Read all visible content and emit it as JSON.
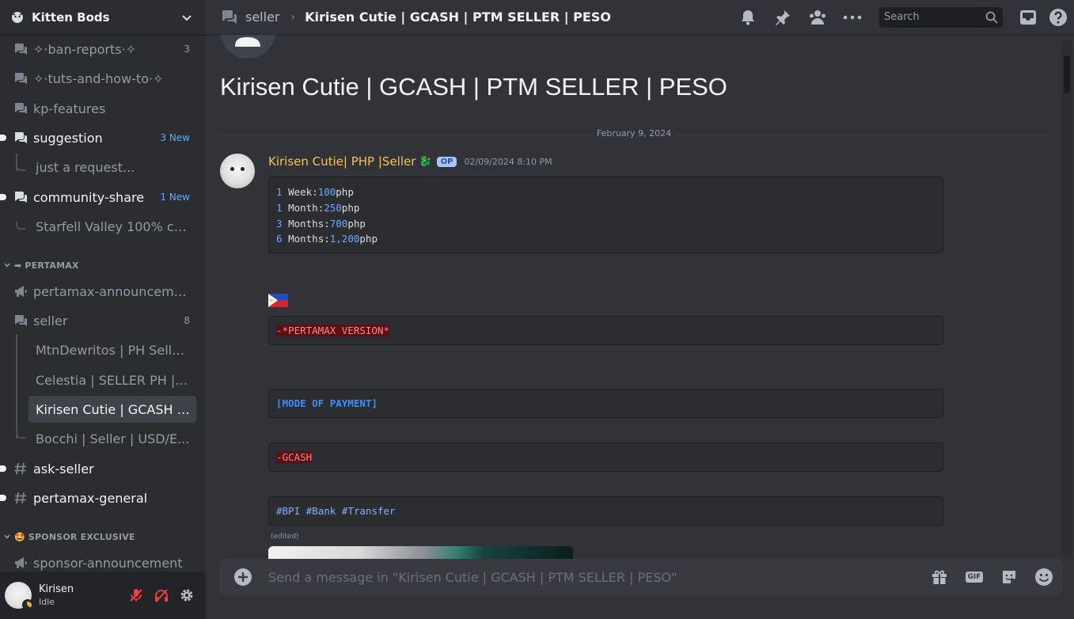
{
  "server": {
    "name": "Kitten Bods"
  },
  "channels": [
    {
      "name": "✧·ban-reports·✧",
      "type": "forum",
      "count": "3",
      "unread": false
    },
    {
      "name": "✧·tuts-and-how-to·✧",
      "type": "forum",
      "unread": false
    },
    {
      "name": "kp-features",
      "type": "forum",
      "unread": false
    },
    {
      "name": "suggestion",
      "type": "forum",
      "new_badge": "3 New",
      "unread": true
    },
    {
      "name": "just a request...",
      "type": "thread",
      "unread": false
    },
    {
      "name": "community-share",
      "type": "forum",
      "new_badge": "1 New",
      "unread": true
    },
    {
      "name": "Starfell Valley 100% co...",
      "type": "thread",
      "unread": false
    },
    {
      "name": "pertamax-announceme...",
      "type": "announcement",
      "unread": false
    },
    {
      "name": "seller",
      "type": "forum",
      "count": "8",
      "unread": false
    },
    {
      "name": "MtnDewritos | PH Selle...",
      "type": "thread"
    },
    {
      "name": "Celestia | SELLER PH | ...",
      "type": "thread"
    },
    {
      "name": "Kirisen Cutie | GCASH | ...",
      "type": "thread",
      "active": true
    },
    {
      "name": "Bocchi | Seller | USD/E...",
      "type": "thread"
    },
    {
      "name": "ask-seller",
      "type": "text",
      "unread": true
    },
    {
      "name": "pertamax-general",
      "type": "text",
      "unread": true
    },
    {
      "name": "sponsor-announcement",
      "type": "announcement",
      "unread": false
    }
  ],
  "categories": [
    {
      "name": "PERTAMAX",
      "emoji": "➡"
    },
    {
      "name": "SPONSOR EXCLUSIVE",
      "emoji": "🤩"
    }
  ],
  "user": {
    "name": "Kirisen",
    "status": "Idle"
  },
  "topbar": {
    "parent": "seller",
    "thread": "Kirisen Cutie | GCASH | PTM SELLER | PESO",
    "search_placeholder": "Search"
  },
  "thread": {
    "title": "Kirisen Cutie | GCASH | PTM SELLER | PESO",
    "date_divider": "February 9, 2024"
  },
  "message": {
    "author": "Kirisen Cutie| PHP |Seller",
    "author_emoji": "🐉",
    "op_badge": "OP",
    "timestamp": "02/09/2024 8:10 PM",
    "price_lines": [
      {
        "qty": "1",
        "unit": "Week:",
        "price": "100",
        "cur": "php"
      },
      {
        "qty": "1",
        "unit": "Month:",
        "price": "250",
        "cur": "php"
      },
      {
        "qty": "3",
        "unit": "Months:",
        "price": "700",
        "cur": "php"
      },
      {
        "qty": "6",
        "unit": "Months:",
        "price": "1,200",
        "cur": "php"
      }
    ],
    "version_line": "-*PERTAMAX VERSION*",
    "payment_heading": "[MODE OF PAYMENT]",
    "gcash_line": "-GCASH",
    "tags": [
      "#BPI",
      "#Bank",
      "#Transfer"
    ],
    "edited_label": "(edited)"
  },
  "composer": {
    "placeholder": "Send a message in \"Kirisen Cutie | GCASH | PTM SELLER | PESO\"",
    "gif_label": "GIF"
  },
  "colors": {
    "background": "#313338",
    "sidebar": "#2b2d31",
    "accent": "#5865f2",
    "idle": "#f0b232",
    "deafened": "#f23f42"
  }
}
